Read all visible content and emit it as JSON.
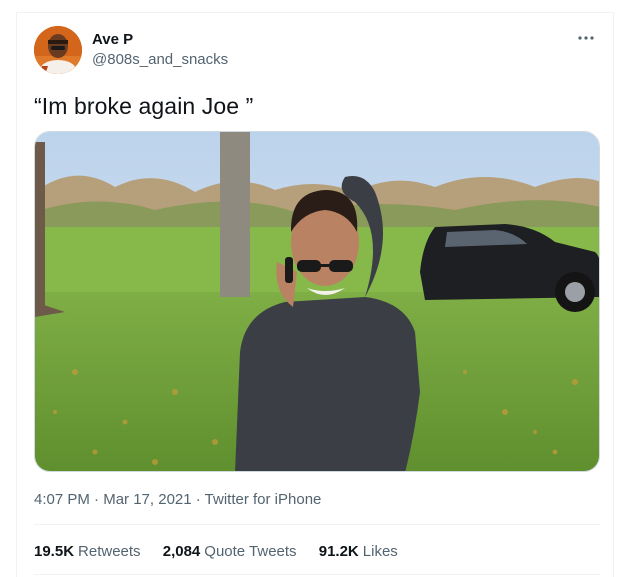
{
  "user": {
    "display_name": "Ave P",
    "handle": "@808s_and_snacks"
  },
  "more_icon": "more-dots-icon",
  "tweet": {
    "text": "“Im broke again Joe ”"
  },
  "meta": {
    "time": "4:07 PM",
    "separator": " · ",
    "date": "Mar 17, 2021",
    "source": "Twitter for iPhone"
  },
  "stats": [
    {
      "count": "19.5K",
      "label": "Retweets"
    },
    {
      "count": "2,084",
      "label": "Quote Tweets"
    },
    {
      "count": "91.2K",
      "label": "Likes"
    }
  ],
  "colors": {
    "secondary_text": "#536471",
    "primary_text": "#0f1419",
    "divider": "#eff3f4",
    "avatar_bg": "#c85a14"
  }
}
